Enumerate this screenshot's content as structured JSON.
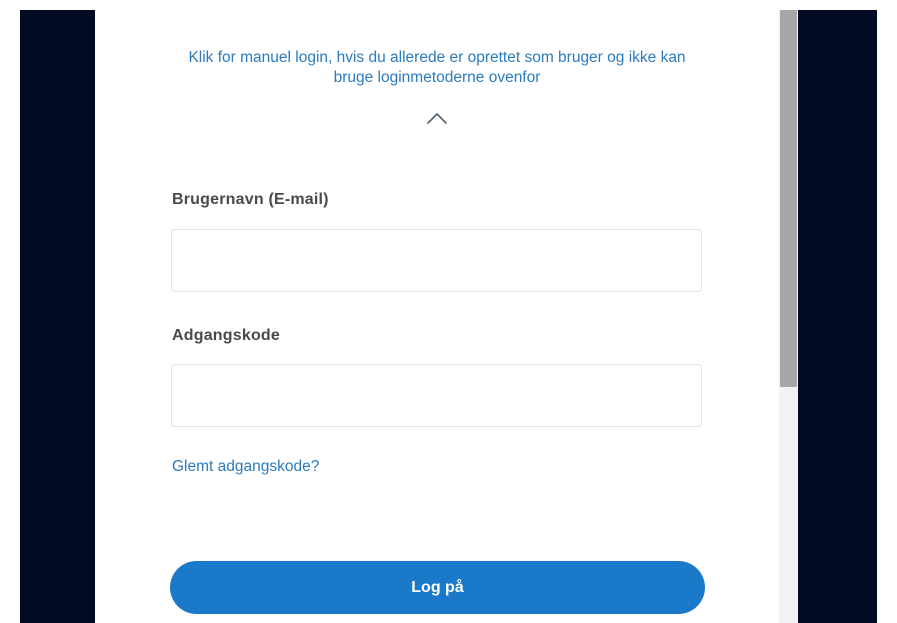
{
  "manual_login": {
    "text_line1": "Klik for manuel login, hvis du allerede er oprettet som bruger og ikke kan",
    "text_line2": "bruge loginmetoderne ovenfor"
  },
  "chevron_icon": "chevron-up-icon",
  "form": {
    "username_label": "Brugernavn (E-mail)",
    "username_value": "",
    "password_label": "Adgangskode",
    "password_value": "",
    "forgot_password": "Glemt adgangskode?",
    "submit_label": "Log på"
  },
  "colors": {
    "background_dark": "#010c24",
    "link": "#2b7bbd",
    "button": "#1a79c8",
    "label": "#4a4a4a"
  }
}
